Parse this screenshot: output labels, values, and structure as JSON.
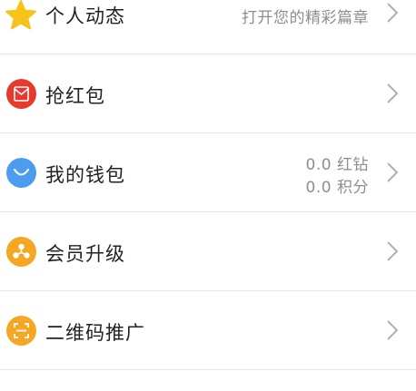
{
  "rows": [
    {
      "label": "个人动态",
      "sub": "打开您的精彩篇章",
      "icon": "star-icon",
      "color": "#f7c21a"
    },
    {
      "label": "抢红包",
      "icon": "red-envelope-icon",
      "color": "#e8392f"
    },
    {
      "label": "我的钱包",
      "sub_line1": "0.0 红钻",
      "sub_line2": "0.0 积分",
      "icon": "wallet-smile-icon",
      "color": "#4c9cf0"
    },
    {
      "label": "会员升级",
      "icon": "member-upgrade-icon",
      "color": "#f5a623"
    },
    {
      "label": "二维码推广",
      "icon": "qr-scan-icon",
      "color": "#f5a623"
    }
  ],
  "colors": {
    "text": "#222222",
    "secondary_text": "#8e8e8e",
    "divider": "#e6e6e6",
    "chevron": "#b0b0b0"
  }
}
